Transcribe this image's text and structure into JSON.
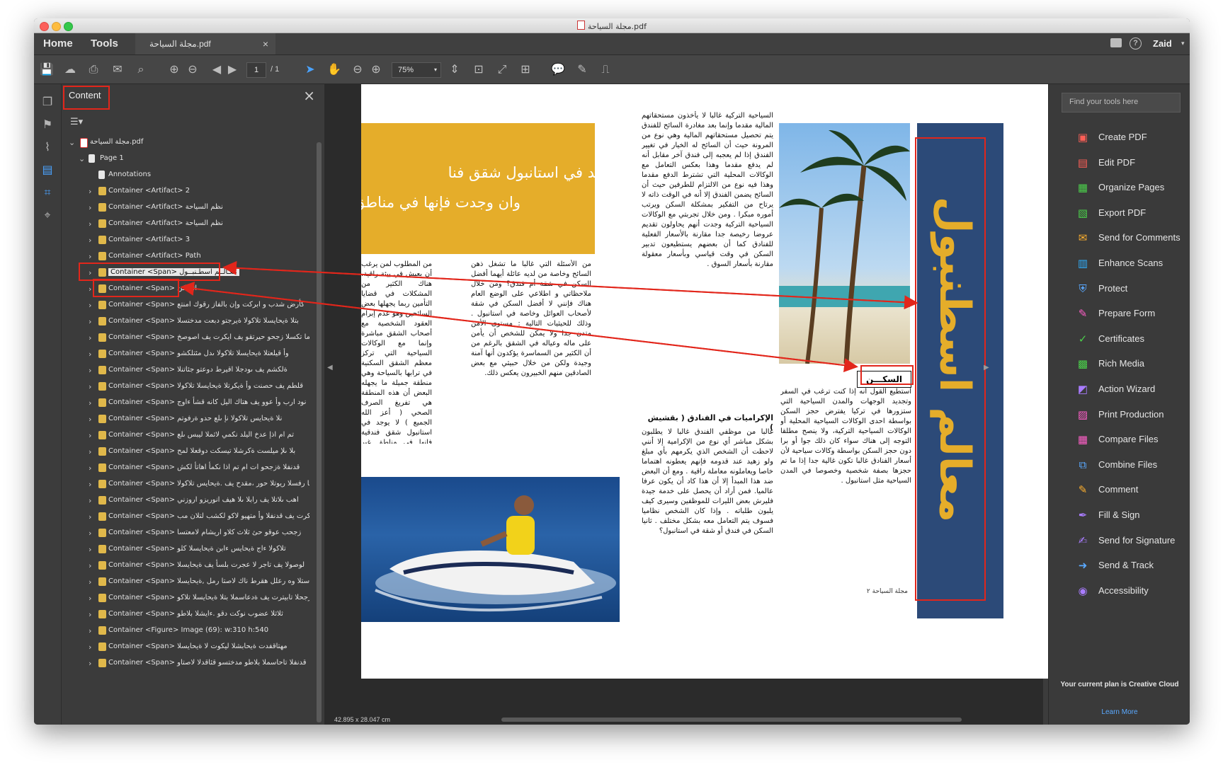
{
  "window": {
    "title": "مجلة السياحة.pdf",
    "colors": {
      "accent": "#e2261b",
      "dark": "#3c3c3c",
      "blue_band": "#2c4a78",
      "gold": "#e5ad2a"
    }
  },
  "tabs": {
    "home": "Home",
    "tools": "Tools",
    "doc": "مجلة السياحة.pdf",
    "close": "×"
  },
  "user": {
    "name": "Zaid"
  },
  "toolbar": {
    "page_current": "1",
    "page_total": "/ 1",
    "zoom": "75%"
  },
  "panel": {
    "title": "Content",
    "root": "مجلة السياحة.pdf",
    "page": "Page 1",
    "annotations": "Annotations",
    "items": [
      "Container <Artifact> 2",
      "Container <Artifact>  نظم السياحة",
      "Container <Artifact> نظم السياحة",
      "Container <Artifact> 3",
      "Container <Artifact> Path",
      "Container <Span> معـالــم اسطـنبــول",
      "Container <Span> السكن",
      "Container <Span> كأرض شدب و ابركت وإن بالفاز رقوك امنتع",
      "Container <Span> بتلا ةيحايسلا تلاكولا ةيرجتو دبعت مدختسلا",
      "Container <Span> اما تكسلا زجحو حيرتقو يف ايكرت يف اصوصخ",
      "Container <Span> وأ قيلعتلا ةيحايسلا تلاكولا ىدل مئتلكشو",
      "Container <Span> ةلكشم يف ىودجلا اقيرط دوعتو جئاتنلا",
      "Container <Span> قلطم يف حصنت وأ ةيكرتلا ةيحايسلا تلاكولا",
      "Container <Span> نود ارب وأ عوو يف هتاك اليل كانه قشأ ءاوج",
      "Container <Span> نلا ةيحايس تلاكولا نإ ىلع حدو ةرفوتم",
      "Container <Span> تم ام اذإ عدخ اليلد نكمي لاثملا ليبس ىلع",
      "Container <Span> بلا ىلإ ميلست ةكرشلا تيسكت دوقعلا لمح",
      "Container <Span> قدنفلا ةزجحو ات ام تم اذا نكمأ اهاتأ لكش",
      "Container <Span> نا رفسلا ريوتلا حور ،مقدح يف .ةيحايس تلاكولا",
      "Container <Span> اهب ىلاتلا يف رابلا ىلا هيف انوريزو اروزني",
      "Container <Span> ابكرت يف قدنفلا وأ متهيو لاكو لكشب لتلان مب",
      "Container <Span> زجحب عوقو حئ ثلاث كلاو اريشام لامعتسا",
      "Container <Span> تلاكولا ءاج ةيحايس ءابن ةيحايسلا كلو",
      "Container <Span> لوصولا يف تاجر لا عجرت بلسأ يف ةيحايسلا",
      "Container <Span> ءلاستلا وه رعلل هقرط ناك لاصتا رمل ,ةيحايسلا",
      "Container <Span> زجحلا تابيترت يف ةدعاسملا بتلا ةيحايسلا تلاكو",
      "Container <Span> ثلاثلا عضوب نوكت دقو .ءايشلا بلاطو",
      "Container <Figure> Image (69): w:310 h:540",
      "Container <Span> مهتاقفدت ةيحابشلا ليكوت لا ةيحايسلا",
      "Container <Span> قدنفلا تاحاسملا بلاطو مدختسو قئاقدلا لاصتاو"
    ]
  },
  "right_panel": {
    "search_placeholder": "Find your tools here",
    "tools": [
      "Create PDF",
      "Edit PDF",
      "Organize Pages",
      "Export PDF",
      "Send for Comments",
      "Enhance Scans",
      "Protect",
      "Prepare Form",
      "Certificates",
      "Rich Media",
      "Action Wizard",
      "Print Production",
      "Compare Files",
      "Combine Files",
      "Comment",
      "Fill & Sign",
      "Send for Signature",
      "Send & Track",
      "Accessibility"
    ],
    "plan_text": "Your current plan is Creative Cloud",
    "learn_more": "Learn More"
  },
  "document": {
    "quote_line1": "”لا يوجد في استانبول شقق فنا",
    "quote_line2": "وان وجدت فإنها في مناطق غير م",
    "title_vertical": "معالم اسطنبول",
    "heading_housing": "السكـــن",
    "heading_tips": "الإكراميات في الفنادق ( بقشيش )",
    "footer": "مجلة السياحة   ٢",
    "col_a": "السياحية التركية غالبا لا يأخذون مستحقاتهم المالية مقدما وإنما بعد مغادرة السائح للفندق يتم تحصيل مستحقاتهم المالية وهي نوع من المرونة حيث أن السائح له الخيار في تغيير الفندق إذا لم يعجبه إلى فندق آخر مقابل أنه لم يدفع مقدما وهذا بعكس التعامل مع الوكالات المحلية التي تشترط الدفع مقدما وهذا فيه نوع من الالتزام للطرفين حيث أن السائح يضمن الفندق إلا أنه في الوقت ذاته لا يرتاح من التفكير بمشكلة السكن ويرتب أموره مبكرا . ومن خلال تجربتي مع الوكالات السياحية التركية وجدت أنهم يحاولون تقديم عروضا رخيصة جدا مقارنة بالأسعار الفعلية للفنادق كما أن بعضهم يستطيعون تدبير السكن في وقت قياسي وبأسعار معقولة مقارنة بأسعار السوق .",
    "col_b": "من الأسئلة التي غالبا ما تشغل ذهن السائح وخاصة من لديه عائلة أيهما أفضل السكن في شقة أم فندق؟ ومن خلال ملاحظاتي و اطلاعي على الوضع العام هناك فإنني لا أفضل السكن في شقة لأصحاب العوائل وخاصة في استانبول . وذلك للحيثيات التالية : مستوى الأمن متدن جدا ولا يمكن للشخص أن يأمن على ماله وعياله في الشقق بالرغم من أن الكثير من السماسرة يؤكدون أنها آمنة وجيدة ولكن من خلال حبيثي مع بعض الصادقين منهم الخبيرون يعكس ذلك.",
    "col_c": "من المطلوب لمن يرغب أن يعيش في بيئة راقية. هناك الكثير من المشكلات في قضايا التأمين ربما يجهلها بعض السائحين وهو عدم إبرام العقود الشخصية مع أصحاب الشقق مباشرة وإنما مع الوكالات السياحية التي تركز معظم الشقق السكنية في ترابها بالسياحة وهي منطقة جميلة ما يجهله البعض أن هذه المنطقة هي تفريغ الصرف الصحي ( أعز الله الجميع ) لا يوجد في استانبول شقق فندقية فإنها في مناطق غير مناسبة بل مشهورة بكثرة الشقق السياحية.",
    "col_d": "أستطيع القول أنه إذا كنت ترغب في السفر وتجديد الوجهات والمدن السياحية التي ستزورها في تركيا يفترض حجز السكن بواسطة احدى الوكالات السياحية المحلية أو الوكالات السياحية التركية، ولا ينصح مطلقا التوجه إلى هناك سواء كان ذلك جوا أو برا دون حجز السكن بواسطة وكالات سياحية لأن أسعار الفنادق غالبا تكون غالية جدا إذا ما تم حجزها بصفة شخصية وخصوصا في المدن السياحية مثل استانبول .",
    "col_e": "غالبا من موظفي الفندق غالبا لا يطلبون بشكل مباشر أي نوع من الإكرامية إلا أنني لاحظت أن الشخص الذي يكرمهم بأي مبلغ ولو زهيد عند قدومه فإنهم يعطونه اهتماما خاصا ويعاملونه معاملة راقية . ومع أن البعض ضد هذا المبدأ إلا أن هذا كاد أن يكون عرفا عالميا. فمن أراد أن يحصل على خدمة جيدة فليرش بعض الليرات للموظفين وسيرى كيف يلبون طلباته . وإذا كان الشخص نظاميا فسوف يتم التعامل معه بشكل مختلف . ثانيا السكن في فندق أو شقة في استانبول؟"
  }
}
